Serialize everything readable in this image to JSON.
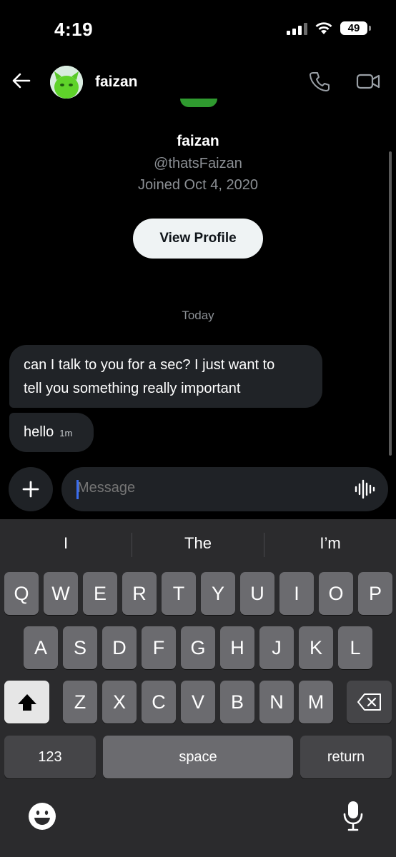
{
  "status": {
    "time": "4:19",
    "battery": "49"
  },
  "header": {
    "name": "faizan"
  },
  "profile": {
    "name": "faizan",
    "handle": "@thatsFaizan",
    "joined": "Joined Oct 4, 2020",
    "view_label": "View Profile"
  },
  "date_label": "Today",
  "messages": [
    {
      "line1": "can I talk to you for a sec? I just want to",
      "line2": "tell you something really important"
    },
    {
      "text": "hello",
      "time": "1m"
    }
  ],
  "composer": {
    "placeholder": "Message"
  },
  "keyboard": {
    "suggestions": [
      "I",
      "The",
      "I’m"
    ],
    "row1": [
      "Q",
      "W",
      "E",
      "R",
      "T",
      "Y",
      "U",
      "I",
      "O",
      "P"
    ],
    "row2": [
      "A",
      "S",
      "D",
      "F",
      "G",
      "H",
      "J",
      "K",
      "L"
    ],
    "row3": [
      "Z",
      "X",
      "C",
      "V",
      "B",
      "N",
      "M"
    ],
    "numbers_label": "123",
    "space_label": "space",
    "return_label": "return"
  },
  "icons": {
    "back": "arrow-left-icon",
    "call": "phone-icon",
    "video": "video-camera-icon",
    "add": "plus-icon",
    "voice": "waveform-icon",
    "shift": "shift-icon",
    "delete": "backspace-icon",
    "emoji": "emoji-icon",
    "dictation": "microphone-icon"
  },
  "colors": {
    "accent_caret": "#3a6df0",
    "bubble": "#202327",
    "button_light": "#eff3f4"
  }
}
